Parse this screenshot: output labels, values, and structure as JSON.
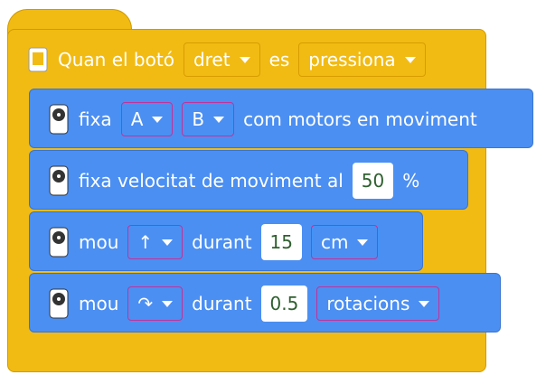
{
  "header": {
    "icon": "device-icon",
    "prefix": "Quan el botó",
    "button_dropdown": "dret",
    "middle": "es",
    "state_dropdown": "pressiona"
  },
  "blocks": [
    {
      "icon": "motor-icon",
      "label": "fixa",
      "dropdown1": "A",
      "dropdown2": "B",
      "suffix": "com motors en moviment"
    },
    {
      "icon": "motor-icon",
      "label": "fixa velocitat de moviment al",
      "value": "50",
      "suffix": "%"
    },
    {
      "icon": "motor-icon",
      "label": "mou",
      "direction": "↑",
      "mid": "durant",
      "value": "15",
      "unit": "cm"
    },
    {
      "icon": "motor-icon",
      "label": "mou",
      "direction": "↷",
      "mid": "durant",
      "value": "0.5",
      "unit": "rotacions"
    }
  ]
}
